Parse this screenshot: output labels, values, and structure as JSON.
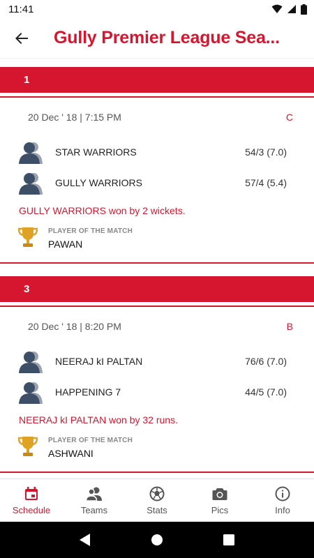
{
  "status_bar": {
    "time": "11:41"
  },
  "app_bar": {
    "title": "Gully Premier League Sea..."
  },
  "matches": [
    {
      "number": "1",
      "date": "20 Dec ' 18 | 7:15 PM",
      "group": "C",
      "teams": [
        {
          "name": "STAR WARRIORS",
          "score": "54/3 (7.0)"
        },
        {
          "name": "GULLY WARRIORS",
          "score": "57/4 (5.4)"
        }
      ],
      "result": "GULLY WARRIORS won by 2 wickets.",
      "potm_label": "PLAYER OF THE MATCH",
      "potm_name": "PAWAN"
    },
    {
      "number": "3",
      "date": "20 Dec ' 18 | 8:20 PM",
      "group": "B",
      "teams": [
        {
          "name": "NEERAJ kI PALTAN",
          "score": "76/6 (7.0)"
        },
        {
          "name": "HAPPENING 7",
          "score": "44/5 (7.0)"
        }
      ],
      "result": "NEERAJ kI PALTAN won by 32 runs.",
      "potm_label": "PLAYER OF THE MATCH",
      "potm_name": "ASHWANI"
    }
  ],
  "bottom_nav": [
    {
      "label": "Schedule",
      "icon": "calendar-icon",
      "active": true
    },
    {
      "label": "Teams",
      "icon": "people-icon",
      "active": false
    },
    {
      "label": "Stats",
      "icon": "football-icon",
      "active": false
    },
    {
      "label": "Pics",
      "icon": "camera-icon",
      "active": false
    },
    {
      "label": "Info",
      "icon": "info-icon",
      "active": false
    }
  ],
  "colors": {
    "accent": "#d6162f",
    "avatar": "#3d4f66",
    "avatar_back": "#9aa3ad",
    "trophy": "#e0a224"
  }
}
